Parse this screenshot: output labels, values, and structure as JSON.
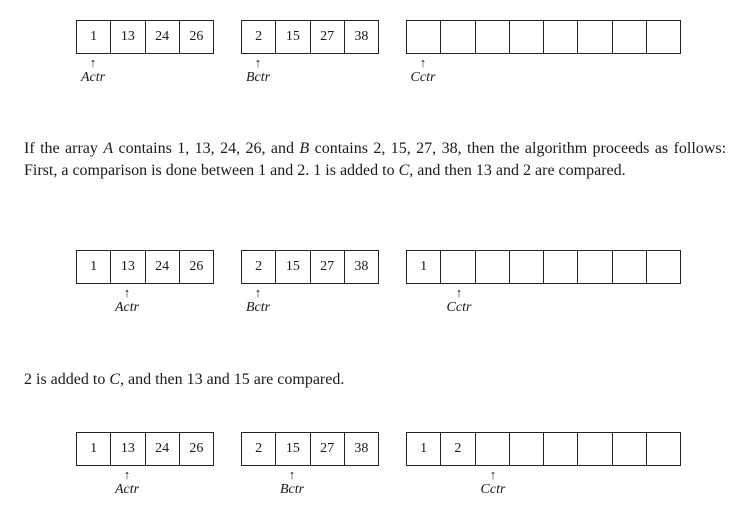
{
  "rows": [
    {
      "A": [
        "1",
        "13",
        "24",
        "26"
      ],
      "B": [
        "2",
        "15",
        "27",
        "38"
      ],
      "C": [
        "",
        "",
        "",
        "",
        "",
        "",
        "",
        ""
      ],
      "pointers": {
        "A_label": "Actr",
        "B_label": "Bctr",
        "C_label": "Cctr",
        "A_index": 0,
        "B_index": 0,
        "C_index": 0
      }
    },
    {
      "A": [
        "1",
        "13",
        "24",
        "26"
      ],
      "B": [
        "2",
        "15",
        "27",
        "38"
      ],
      "C": [
        "1",
        "",
        "",
        "",
        "",
        "",
        "",
        ""
      ],
      "pointers": {
        "A_label": "Actr",
        "B_label": "Bctr",
        "C_label": "Cctr",
        "A_index": 1,
        "B_index": 0,
        "C_index": 1
      }
    },
    {
      "A": [
        "1",
        "13",
        "24",
        "26"
      ],
      "B": [
        "2",
        "15",
        "27",
        "38"
      ],
      "C": [
        "1",
        "2",
        "",
        "",
        "",
        "",
        "",
        ""
      ],
      "pointers": {
        "A_label": "Actr",
        "B_label": "Bctr",
        "C_label": "Cctr",
        "A_index": 1,
        "B_index": 1,
        "C_index": 2
      }
    }
  ],
  "text": {
    "para1": {
      "p1": "If the array ",
      "A": "A",
      "p2": " contains 1, 13, 24, 26, and ",
      "B": "B",
      "p3": " contains 2, 15, 27, 38, then the algorithm proceeds as follows: First, a comparison is done between 1 and 2. 1 is added to ",
      "C": "C",
      "p4": ", and then 13 and 2 are compared."
    },
    "para2": {
      "p1": "2 is added to ",
      "C": "C",
      "p2": ", and then 13 and 15 are compared."
    }
  },
  "arrow_glyph": "↑"
}
